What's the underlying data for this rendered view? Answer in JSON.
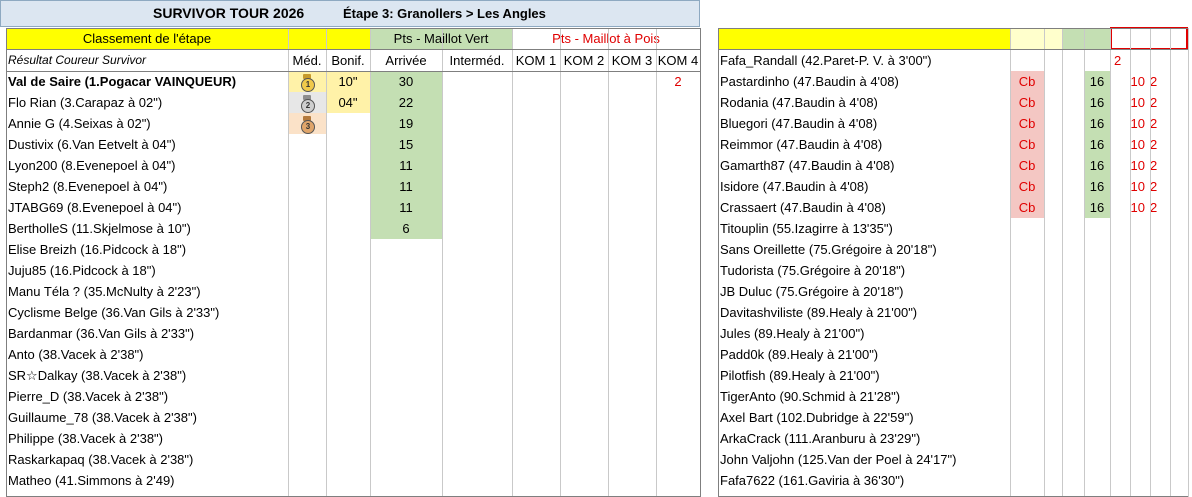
{
  "title": "SURVIVOR TOUR 2026",
  "stage": "Étape 3: Granollers > Les Angles",
  "header": {
    "classement": "Classement de l'étape",
    "maillot_vert": "Pts - Maillot Vert",
    "maillot_pois": "Pts - Maillot à Pois",
    "col_resultat": "Résultat  Coureur Survivor",
    "col_med": "Méd.",
    "col_bonif": "Bonif.",
    "col_arrivee": "Arrivée",
    "col_interm": "Interméd.",
    "col_kom1": "KOM 1",
    "col_kom2": "KOM 2",
    "col_kom3": "KOM 3",
    "col_kom4": "KOM 4"
  },
  "colors": {
    "yellow": "#ffff00",
    "green": "#c4dfb3",
    "pink": "#f4c7c3",
    "title_bg": "#dce6f1",
    "red": "#e00000"
  },
  "left_rows": [
    {
      "name": "Val de Saire (1.Pogacar VAINQUEUR)",
      "medal": "1",
      "bonif": "10\"",
      "arrivee": "30",
      "kom4": "2"
    },
    {
      "name": "Flo Rian (3.Carapaz à 02\")",
      "medal": "2",
      "bonif": "04\"",
      "arrivee": "22",
      "kom4": ""
    },
    {
      "name": "Annie G (4.Seixas à 02\")",
      "medal": "3",
      "bonif": "",
      "arrivee": "19",
      "kom4": ""
    },
    {
      "name": "Dustivix (6.Van Eetvelt à 04\")",
      "medal": "",
      "bonif": "",
      "arrivee": "15",
      "kom4": ""
    },
    {
      "name": "Lyon200 (8.Evenepoel à 04\")",
      "medal": "",
      "bonif": "",
      "arrivee": "11",
      "kom4": ""
    },
    {
      "name": "Steph2 (8.Evenepoel à 04\")",
      "medal": "",
      "bonif": "",
      "arrivee": "11",
      "kom4": ""
    },
    {
      "name": "JTABG69 (8.Evenepoel à 04\")",
      "medal": "",
      "bonif": "",
      "arrivee": "11",
      "kom4": ""
    },
    {
      "name": "BertholleS (11.Skjelmose à 10\")",
      "medal": "",
      "bonif": "",
      "arrivee": "6",
      "kom4": ""
    },
    {
      "name": "Elise Breizh (16.Pidcock à 18\")",
      "medal": "",
      "bonif": "",
      "arrivee": "",
      "kom4": ""
    },
    {
      "name": "Juju85 (16.Pidcock à 18\")",
      "medal": "",
      "bonif": "",
      "arrivee": "",
      "kom4": ""
    },
    {
      "name": "Manu Téla ? (35.McNulty à 2'23\")",
      "medal": "",
      "bonif": "",
      "arrivee": "",
      "kom4": ""
    },
    {
      "name": "Cyclisme Belge (36.Van Gils à 2'33\")",
      "medal": "",
      "bonif": "",
      "arrivee": "",
      "kom4": ""
    },
    {
      "name": "Bardanmar (36.Van Gils à 2'33\")",
      "medal": "",
      "bonif": "",
      "arrivee": "",
      "kom4": ""
    },
    {
      "name": "Anto (38.Vacek à 2'38\")",
      "medal": "",
      "bonif": "",
      "arrivee": "",
      "kom4": ""
    },
    {
      "name": "SR☆Dalkay (38.Vacek à 2'38\")",
      "medal": "",
      "bonif": "",
      "arrivee": "",
      "kom4": ""
    },
    {
      "name": "Pierre_D (38.Vacek à 2'38\")",
      "medal": "",
      "bonif": "",
      "arrivee": "",
      "kom4": ""
    },
    {
      "name": "Guillaume_78 (38.Vacek à 2'38\")",
      "medal": "",
      "bonif": "",
      "arrivee": "",
      "kom4": ""
    },
    {
      "name": "Philippe (38.Vacek à 2'38\")",
      "medal": "",
      "bonif": "",
      "arrivee": "",
      "kom4": ""
    },
    {
      "name": "Raskarkapaq (38.Vacek à 2'38\")",
      "medal": "",
      "bonif": "",
      "arrivee": "",
      "kom4": ""
    },
    {
      "name": "Matheo (41.Simmons à 2'49)",
      "medal": "",
      "bonif": "",
      "arrivee": "",
      "kom4": ""
    }
  ],
  "right_rows": [
    {
      "name": "Fafa_Randall (42.Paret-P. V. à 3'00\")",
      "cb": "",
      "pts": "",
      "a": "2",
      "b": ""
    },
    {
      "name": "Pastardinho (47.Baudin à 4'08)",
      "cb": "Cb",
      "pts": "16",
      "a": "10",
      "b": "2"
    },
    {
      "name": "Rodania (47.Baudin à 4'08)",
      "cb": "Cb",
      "pts": "16",
      "a": "10",
      "b": "2"
    },
    {
      "name": "Bluegori (47.Baudin à 4'08)",
      "cb": "Cb",
      "pts": "16",
      "a": "10",
      "b": "2"
    },
    {
      "name": "Reimmor (47.Baudin à 4'08)",
      "cb": "Cb",
      "pts": "16",
      "a": "10",
      "b": "2"
    },
    {
      "name": "Gamarth87 (47.Baudin à 4'08)",
      "cb": "Cb",
      "pts": "16",
      "a": "10",
      "b": "2"
    },
    {
      "name": "Isidore (47.Baudin à 4'08)",
      "cb": "Cb",
      "pts": "16",
      "a": "10",
      "b": "2"
    },
    {
      "name": "Crassaert (47.Baudin à 4'08)",
      "cb": "Cb",
      "pts": "16",
      "a": "10",
      "b": "2"
    },
    {
      "name": "Titouplin (55.Izagirre à 13'35\")",
      "cb": "",
      "pts": "",
      "a": "",
      "b": ""
    },
    {
      "name": "Sans Oreillette (75.Grégoire à 20'18\")",
      "cb": "",
      "pts": "",
      "a": "",
      "b": ""
    },
    {
      "name": "Tudorista (75.Grégoire à 20'18\")",
      "cb": "",
      "pts": "",
      "a": "",
      "b": ""
    },
    {
      "name": "JB Duluc (75.Grégoire à 20'18\")",
      "cb": "",
      "pts": "",
      "a": "",
      "b": ""
    },
    {
      "name": "Davitashviliste (89.Healy à 21'00\")",
      "cb": "",
      "pts": "",
      "a": "",
      "b": ""
    },
    {
      "name": "Jules (89.Healy à 21'00\")",
      "cb": "",
      "pts": "",
      "a": "",
      "b": ""
    },
    {
      "name": "Padd0k (89.Healy à 21'00\")",
      "cb": "",
      "pts": "",
      "a": "",
      "b": ""
    },
    {
      "name": "Pilotfish (89.Healy à 21'00\")",
      "cb": "",
      "pts": "",
      "a": "",
      "b": ""
    },
    {
      "name": "TigerAnto (90.Schmid à 21'28\")",
      "cb": "",
      "pts": "",
      "a": "",
      "b": ""
    },
    {
      "name": "Axel Bart (102.Dubridge à 22'59\")",
      "cb": "",
      "pts": "",
      "a": "",
      "b": ""
    },
    {
      "name": "ArkaCrack (111.Aranburu à 23'29\")",
      "cb": "",
      "pts": "",
      "a": "",
      "b": ""
    },
    {
      "name": "John Valjohn (125.Van der Poel à 24'17\")",
      "cb": "",
      "pts": "",
      "a": "",
      "b": ""
    },
    {
      "name": "Fafa7622 (161.Gaviria à 36'30\")",
      "cb": "",
      "pts": "",
      "a": "",
      "b": ""
    }
  ]
}
